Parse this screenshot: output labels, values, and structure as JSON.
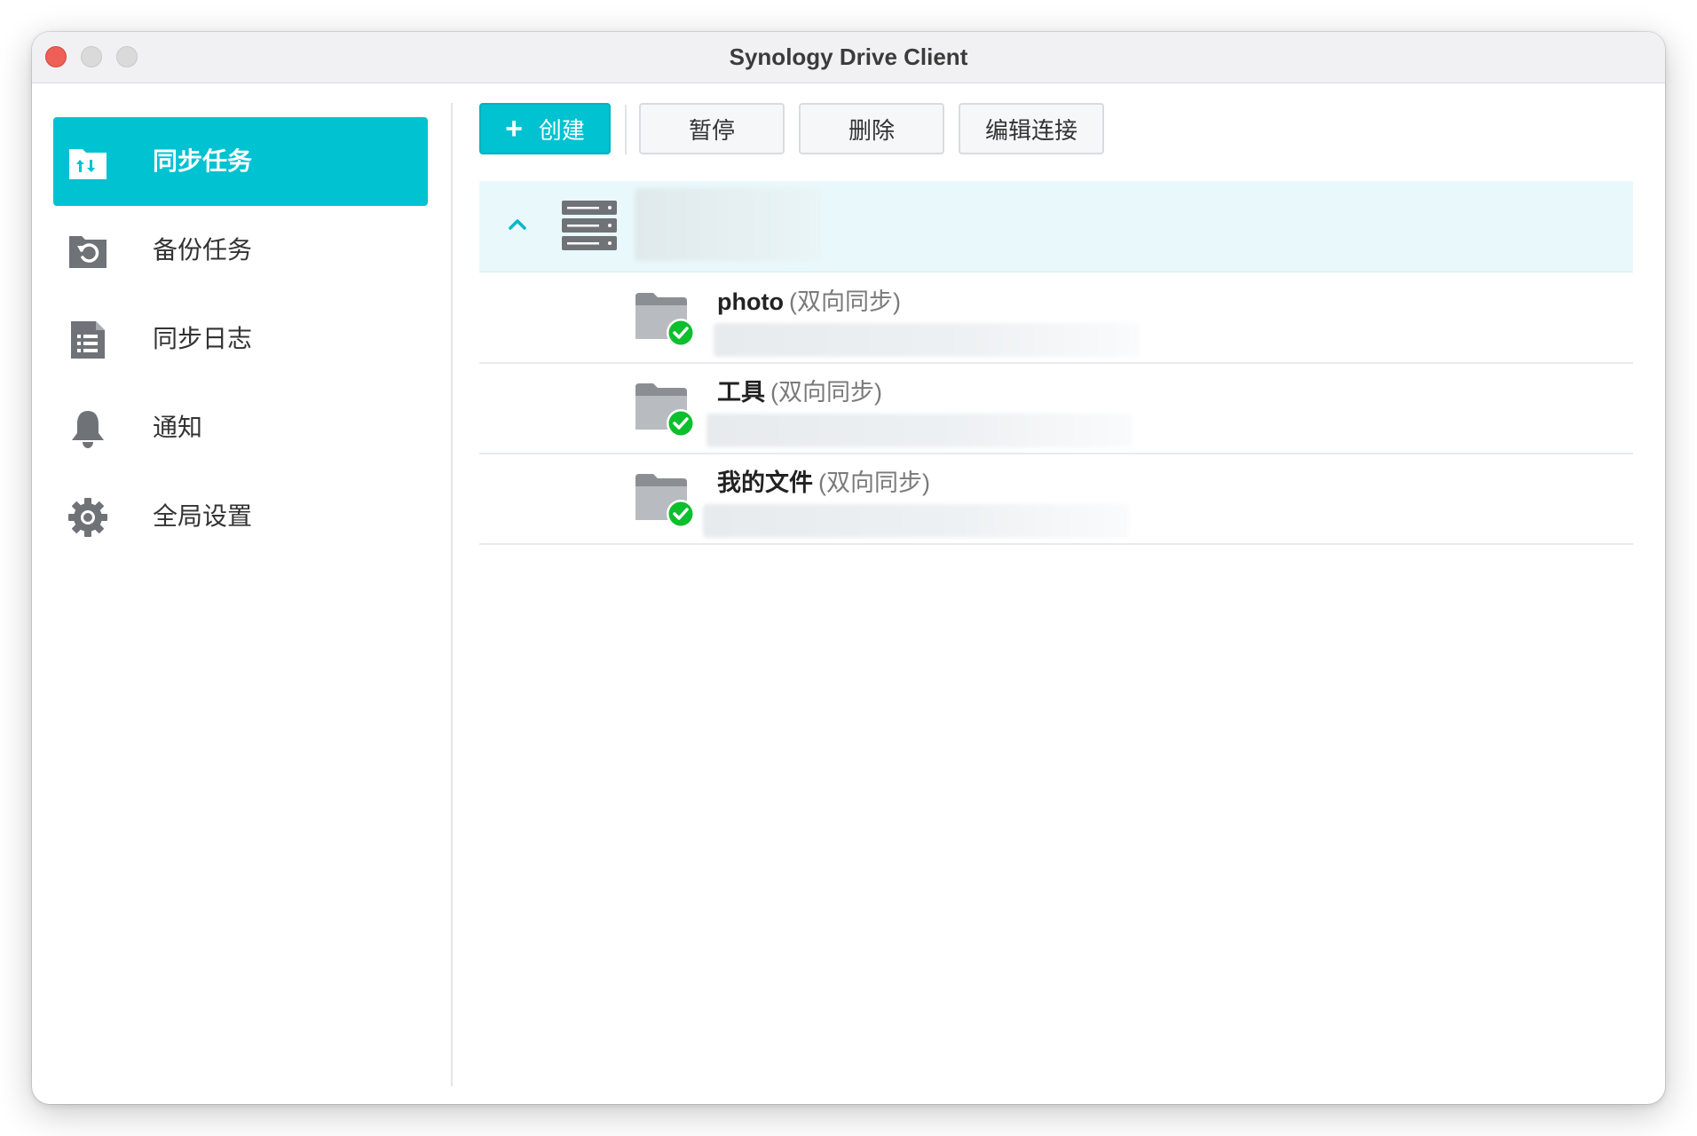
{
  "window": {
    "title": "Synology Drive Client"
  },
  "sidebar": {
    "items": [
      {
        "label": "同步任务",
        "icon": "sync-folder-icon",
        "active": true
      },
      {
        "label": "备份任务",
        "icon": "backup-folder-icon",
        "active": false
      },
      {
        "label": "同步日志",
        "icon": "log-list-icon",
        "active": false
      },
      {
        "label": "通知",
        "icon": "bell-icon",
        "active": false
      },
      {
        "label": "全局设置",
        "icon": "gear-icon",
        "active": false
      }
    ]
  },
  "toolbar": {
    "create_label": "创建",
    "pause_label": "暂停",
    "delete_label": "删除",
    "edit_connection_label": "编辑连接"
  },
  "server": {
    "icon": "server-icon",
    "name": "",
    "expanded": true
  },
  "sync_tasks": [
    {
      "name": "photo",
      "mode": "(双向同步)",
      "status_icon": "check-icon",
      "path": ""
    },
    {
      "name": "工具",
      "mode": "(双向同步)",
      "status_icon": "check-icon",
      "path": ""
    },
    {
      "name": "我的文件",
      "mode": "(双向同步)",
      "status_icon": "check-icon",
      "path": ""
    }
  ],
  "colors": {
    "accent": "#00c2d1",
    "selected_row": "#e9f8fa",
    "status_ok": "#0cbf2d",
    "icon_gray": "#6f7378"
  }
}
